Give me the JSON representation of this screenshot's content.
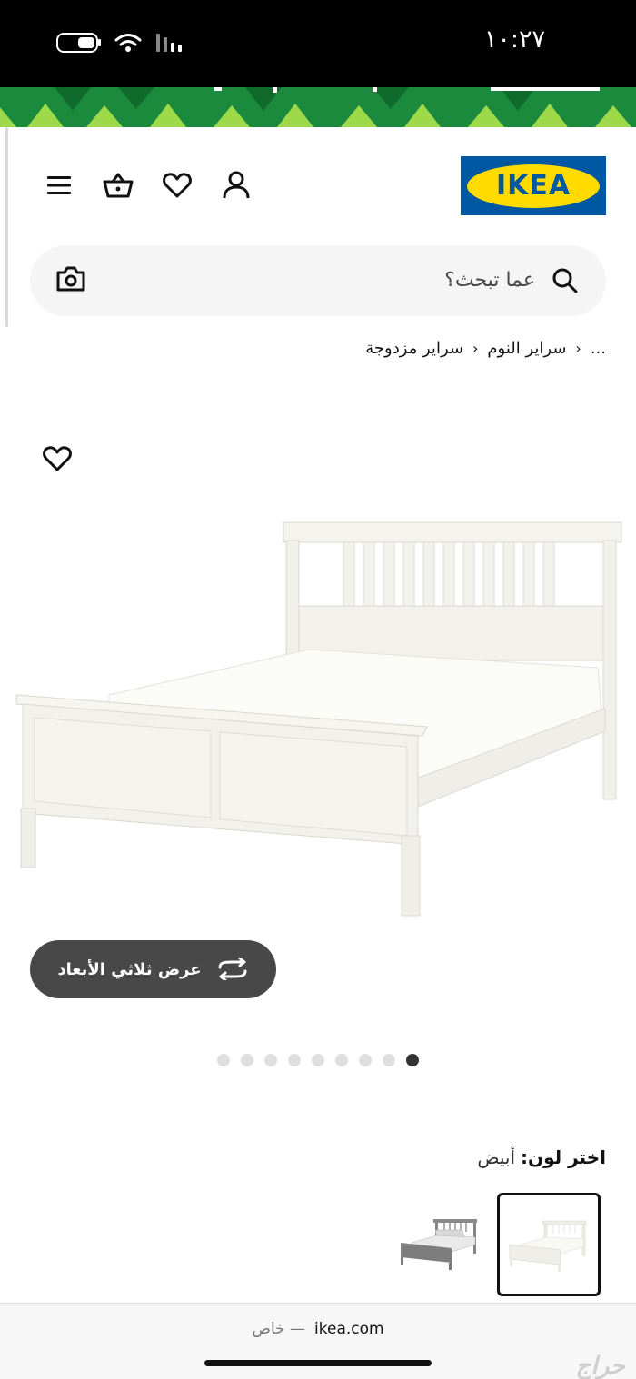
{
  "status_bar": {
    "time": "١٠:٢٧"
  },
  "header": {
    "logo_text": "IKEA",
    "icons": [
      "menu-icon",
      "basket-icon",
      "heart-icon",
      "user-icon"
    ]
  },
  "search": {
    "placeholder": "عما تبحث؟"
  },
  "breadcrumb": {
    "items": [
      "...",
      "سراير النوم",
      "سراير مزدوجة"
    ]
  },
  "product": {
    "view_3d_label": "عرض ثلاثي الأبعاد",
    "image_count": 9,
    "active_image_index": 8
  },
  "color_picker": {
    "label": "اختر لون:",
    "selected_value": "أبيض"
  },
  "browser": {
    "domain": "ikea.com",
    "private_label": "خاص —"
  },
  "watermark": "حراج",
  "colors": {
    "brand_blue": "#0058a3",
    "brand_yellow": "#ffdb00",
    "banner_green": "#1c8a3c",
    "button_dark": "#484848"
  }
}
